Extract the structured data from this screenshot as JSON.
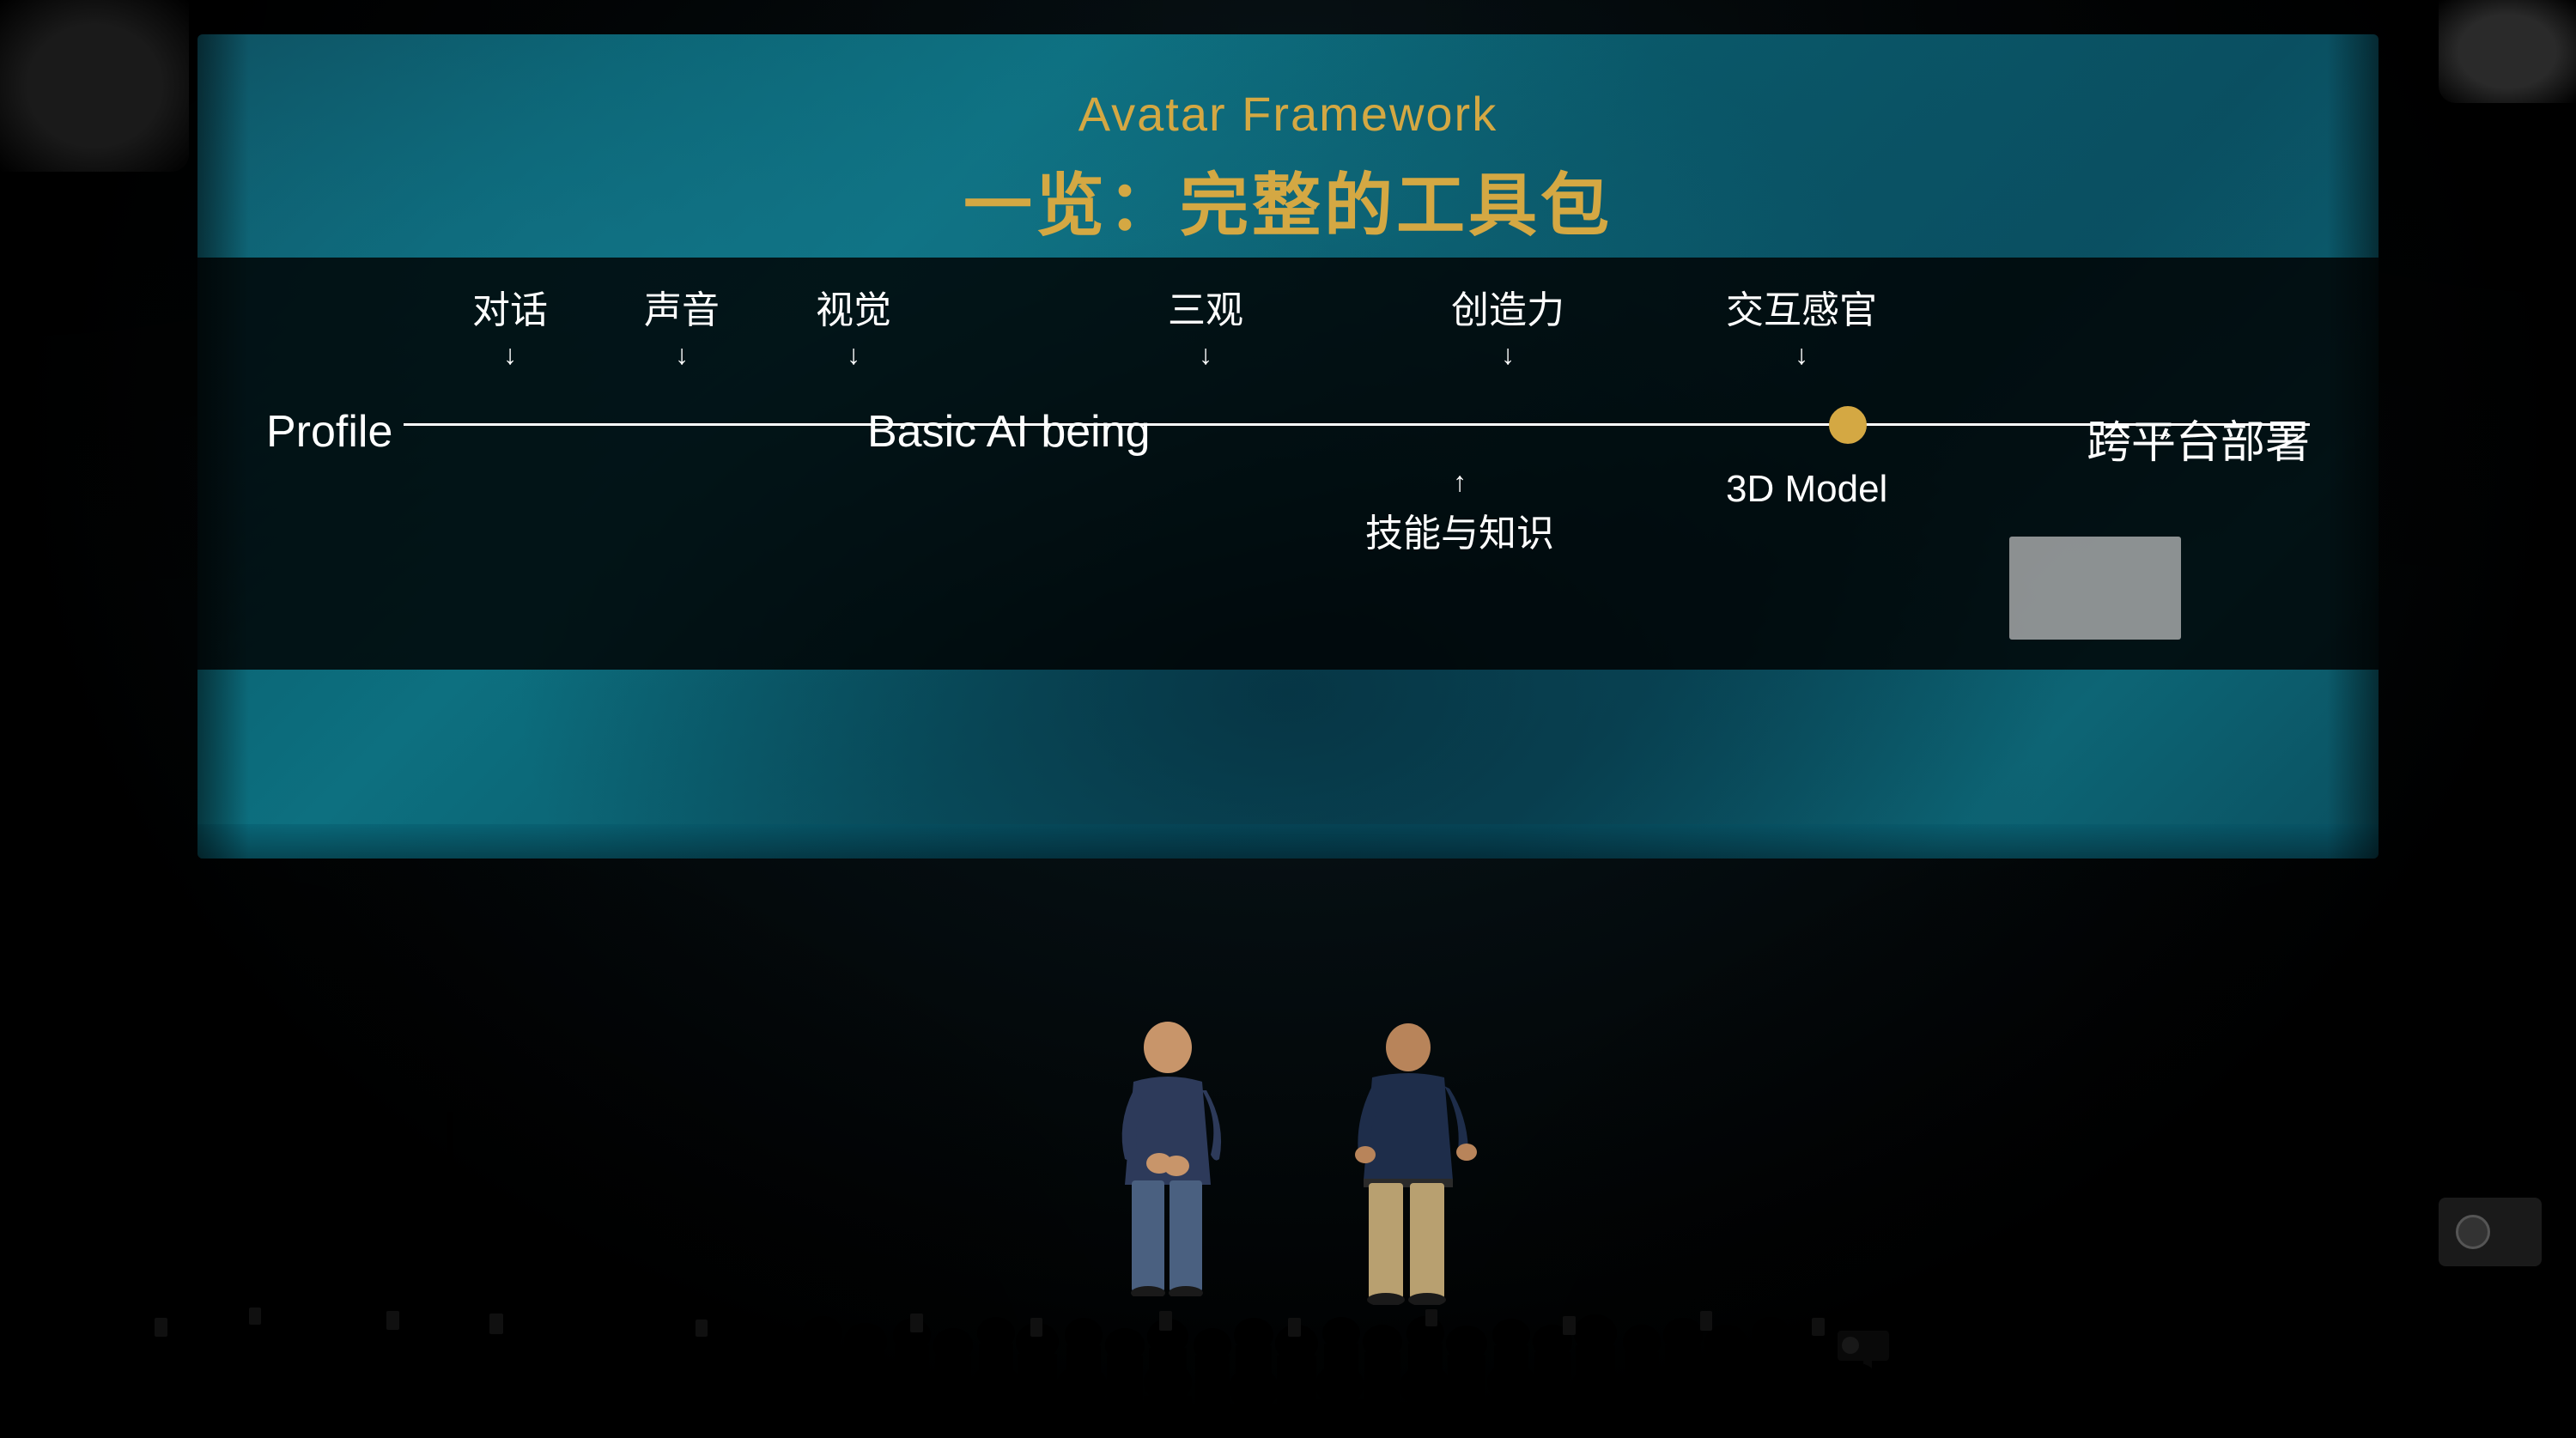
{
  "slide": {
    "title_en": "Avatar Framework",
    "title_zh": "一览：完整的工具包",
    "diagram": {
      "left_node": "Profile",
      "middle_node": "Basic AI being",
      "right_node": "跨平台部署",
      "top_labels": [
        {
          "text": "对话",
          "left_pct": 11
        },
        {
          "text": "声音",
          "left_pct": 22
        },
        {
          "text": "视觉",
          "left_pct": 33
        },
        {
          "text": "三观",
          "left_pct": 52
        },
        {
          "text": "创造力",
          "left_pct": 68
        },
        {
          "text": "交互感官",
          "left_pct": 83
        }
      ],
      "bottom_labels": [
        {
          "text": "技能与知识",
          "left_pct": 62
        },
        {
          "text": "3D Model",
          "left_pct": 75
        }
      ]
    }
  },
  "presenters": [
    {
      "id": "presenter-1"
    },
    {
      "id": "presenter-2"
    }
  ]
}
